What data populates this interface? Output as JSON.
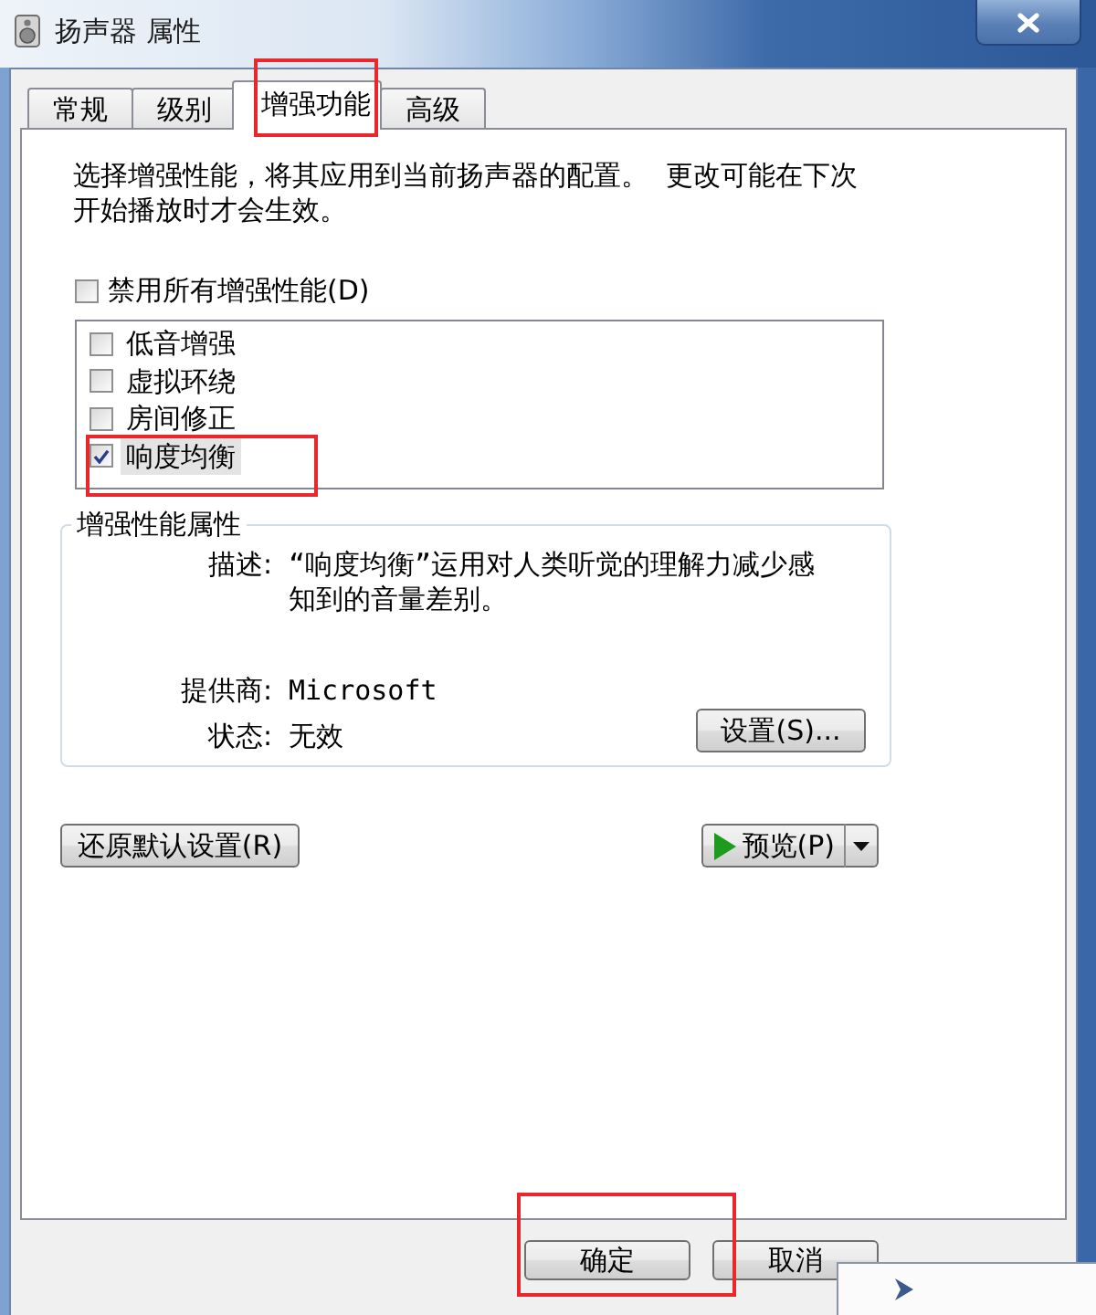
{
  "window": {
    "title": "扬声器 属性"
  },
  "tabs": [
    {
      "label": "常规",
      "selected": false,
      "highlighted": false
    },
    {
      "label": "级别",
      "selected": false,
      "highlighted": false
    },
    {
      "label": "增强功能",
      "selected": true,
      "highlighted": true
    },
    {
      "label": "高级",
      "selected": false,
      "highlighted": false
    }
  ],
  "intro": "选择增强性能，将其应用到当前扬声器的配置。  更改可能在下次开始播放时才会生效。",
  "disable_all": {
    "label": "禁用所有增强性能(D)",
    "checked": false
  },
  "enhancements": [
    {
      "label": "低音增强",
      "checked": false,
      "selected": false,
      "highlighted": false
    },
    {
      "label": "虚拟环绕",
      "checked": false,
      "selected": false,
      "highlighted": false
    },
    {
      "label": "房间修正",
      "checked": false,
      "selected": false,
      "highlighted": false
    },
    {
      "label": "响度均衡",
      "checked": true,
      "selected": true,
      "highlighted": true
    }
  ],
  "properties": {
    "title": "增强性能属性",
    "description": {
      "label": "描述:",
      "value": "“响度均衡”运用对人类听觉的理解力减少感知到的音量差别。"
    },
    "provider": {
      "label": "提供商:",
      "value": "Microsoft"
    },
    "status": {
      "label": "状态:",
      "value": "无效"
    },
    "settings_button": "设置(S)..."
  },
  "restore_button": "还原默认设置(R)",
  "preview_button": "预览(P)",
  "footer_buttons": [
    {
      "label": "确定",
      "highlighted": true
    },
    {
      "label": "取消",
      "highlighted": false
    }
  ]
}
